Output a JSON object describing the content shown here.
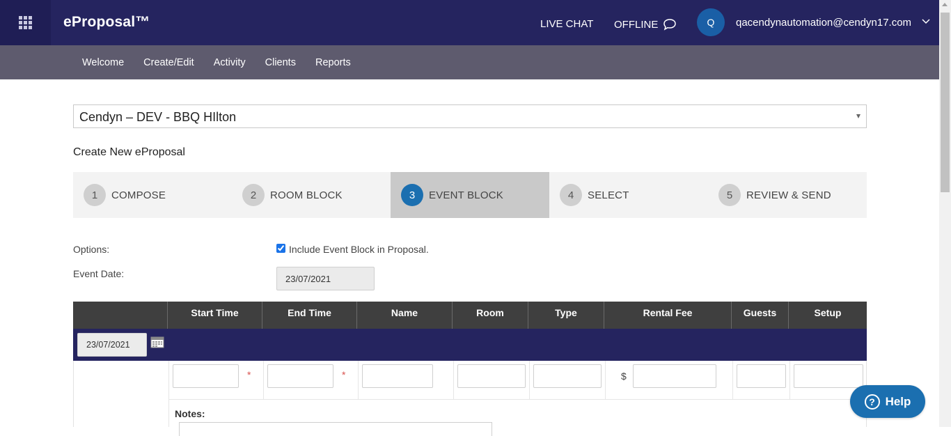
{
  "header": {
    "brand": "eProposal™",
    "live_chat": "LIVE CHAT",
    "offline": "OFFLINE",
    "avatar_initial": "Q",
    "user_email": "qacendynautomation@cendyn17.com",
    "bg_color": "#25245f"
  },
  "nav": {
    "items": [
      {
        "label": "Welcome"
      },
      {
        "label": "Create/Edit"
      },
      {
        "label": "Activity"
      },
      {
        "label": "Clients"
      },
      {
        "label": "Reports"
      }
    ]
  },
  "property_select": {
    "value": "Cendyn – DEV - BBQ HIlton"
  },
  "page_heading": "Create New eProposal",
  "steps": [
    {
      "num": "1",
      "label": "COMPOSE",
      "active": false
    },
    {
      "num": "2",
      "label": "ROOM BLOCK",
      "active": false
    },
    {
      "num": "3",
      "label": "EVENT BLOCK",
      "active": true
    },
    {
      "num": "4",
      "label": "SELECT",
      "active": false
    },
    {
      "num": "5",
      "label": "REVIEW & SEND",
      "active": false
    }
  ],
  "options": {
    "label": "Options:",
    "include_checkbox_label": "Include Event Block in Proposal.",
    "include_checked": true,
    "event_date_label": "Event Date:",
    "event_date_value": "23/07/2021"
  },
  "table": {
    "headers": [
      "",
      "Start Time",
      "End Time",
      "Name",
      "Room",
      "Type",
      "Rental Fee",
      "Guests",
      "Setup"
    ],
    "row_date": "23/07/2021",
    "currency_symbol": "$",
    "required_mark": "*",
    "notes_label": "Notes:"
  },
  "help_button": {
    "label": "Help",
    "icon_glyph": "?"
  },
  "colors": {
    "accent": "#1b6fb0",
    "nav_bg": "#5e5b6e",
    "table_header_bg": "#3f3f3f"
  }
}
